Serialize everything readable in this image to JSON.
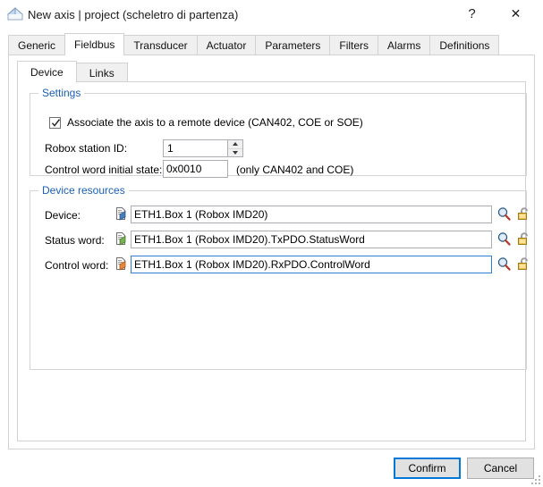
{
  "window": {
    "title": "New axis | project (scheletro di partenza)",
    "app_icon": "axis-window-icon",
    "help_label": "?",
    "close_label": "✕"
  },
  "tabs_outer": [
    {
      "label": "Generic",
      "active": false
    },
    {
      "label": "Fieldbus",
      "active": true
    },
    {
      "label": "Transducer",
      "active": false
    },
    {
      "label": "Actuator",
      "active": false
    },
    {
      "label": "Parameters",
      "active": false
    },
    {
      "label": "Filters",
      "active": false
    },
    {
      "label": "Alarms",
      "active": false
    },
    {
      "label": "Definitions",
      "active": false
    }
  ],
  "tabs_inner": [
    {
      "label": "Device",
      "active": true
    },
    {
      "label": "Links",
      "active": false
    }
  ],
  "settings": {
    "legend": "Settings",
    "associate_checkbox": {
      "label": "Associate the axis to a remote device (CAN402, COE or SOE)",
      "checked": true
    },
    "station_id": {
      "label": "Robox station ID:",
      "value": "1"
    },
    "control_word_initial_state": {
      "label": "Control word initial state:",
      "value": "0x0010",
      "hint": "(only CAN402 and COE)"
    }
  },
  "device_resources": {
    "legend": "Device resources",
    "rows": [
      {
        "label": "Device:",
        "value": "ETH1.Box 1 (Robox IMD20)",
        "doc_icon": "document-blue-icon",
        "doc_icon_color": "#4a7ebb",
        "search_icon": "magnifier-icon",
        "lock_icon": "unlocked-padlock-icon",
        "focused": false
      },
      {
        "label": "Status word:",
        "value": "ETH1.Box 1 (Robox IMD20).TxPDO.StatusWord",
        "doc_icon": "document-green-icon",
        "doc_icon_color": "#76b153",
        "search_icon": "magnifier-icon",
        "lock_icon": "unlocked-padlock-icon",
        "focused": false
      },
      {
        "label": "Control word:",
        "value": "ETH1.Box 1 (Robox IMD20).RxPDO.ControlWord",
        "doc_icon": "document-orange-icon",
        "doc_icon_color": "#e8873a",
        "search_icon": "magnifier-icon",
        "lock_icon": "unlocked-padlock-icon",
        "focused": true
      }
    ]
  },
  "footer": {
    "confirm_label": "Confirm",
    "cancel_label": "Cancel"
  },
  "colors": {
    "accent": "#0078d7",
    "group_legend": "#1a5fb4",
    "window_bg": "#ffffff",
    "control_bg": "#f0f0f0"
  }
}
